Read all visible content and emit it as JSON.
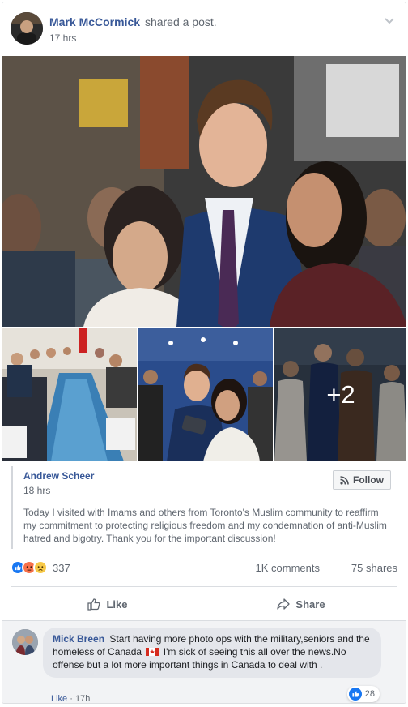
{
  "post": {
    "author": "Mark McCormick",
    "action": "shared a post.",
    "time": "17 hrs",
    "photos": {
      "more_count": "+2"
    }
  },
  "shared": {
    "author": "Andrew Scheer",
    "time": "18 hrs",
    "follow_label": "Follow",
    "text": "Today I visited with Imams and others from Toronto's Muslim community to reaffirm my commitment to protecting religious freedom and my condemnation of anti-Muslim hatred and bigotry. Thank you for the important discussion!"
  },
  "stats": {
    "reactions_count": "337",
    "comments": "1K comments",
    "shares": "75 shares"
  },
  "actions": {
    "like": "Like",
    "share": "Share"
  },
  "comment": {
    "author": "Mick Breen",
    "text_before_flag": "Start having more photo ops with the military,seniors and the homeless of Canada",
    "text_after_flag": "I'm sick of seeing this all over the news.No offense but a lot more important things in Canada to deal with .",
    "reaction_count": "28",
    "like_label": "Like",
    "time": "17h"
  },
  "colors": {
    "link_blue": "#385898",
    "like_blue": "#1877f2",
    "angry_orange": "#f7714b",
    "sad_yellow": "#f7c948"
  }
}
